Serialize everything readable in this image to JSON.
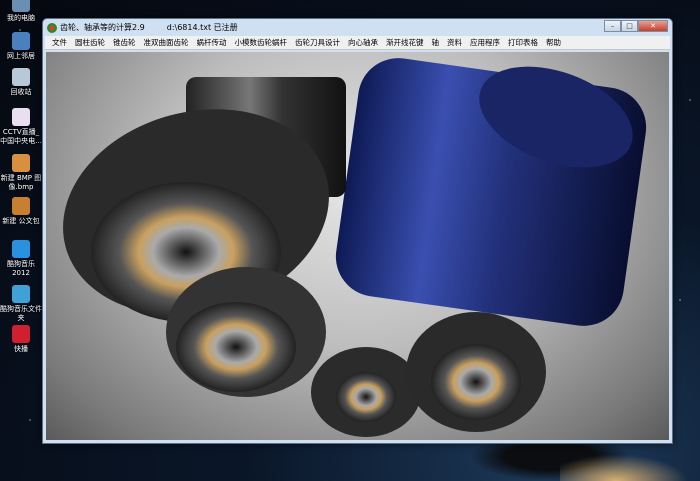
{
  "desktop": {
    "icons": [
      {
        "label": "我的电脑",
        "color": "#6a8fb0"
      },
      {
        "label": "网上邻居",
        "color": "#4a7fc0"
      },
      {
        "label": "回收站",
        "color": "#b8c8d8"
      },
      {
        "label": "CCTV直播_中国中央电...",
        "color": "#e8e0f0"
      },
      {
        "label": "新建 BMP 图像.bmp",
        "color": "#d89040"
      },
      {
        "label": "新建 公文包",
        "color": "#c88030"
      },
      {
        "label": "酷狗音乐2012",
        "color": "#2a90e0"
      },
      {
        "label": "酷狗音乐文件夹",
        "color": "#40a0d8"
      },
      {
        "label": "快播",
        "color": "#d02030"
      }
    ]
  },
  "window": {
    "title": "齿轮、轴承等的计算2.9",
    "file": "d:\\6814.txt 已注册",
    "controls": {
      "minimize": "–",
      "maximize": "□",
      "close": "✕"
    },
    "menu": [
      "文件",
      "圆柱齿轮",
      "锥齿轮",
      "准双曲面齿轮",
      "蜗杆传动",
      "小模数齿轮蜗杆",
      "齿轮刀具设计",
      "向心轴承",
      "渐开线花键",
      "轴",
      "资料",
      "应用程序",
      "打印表格",
      "帮助"
    ]
  }
}
